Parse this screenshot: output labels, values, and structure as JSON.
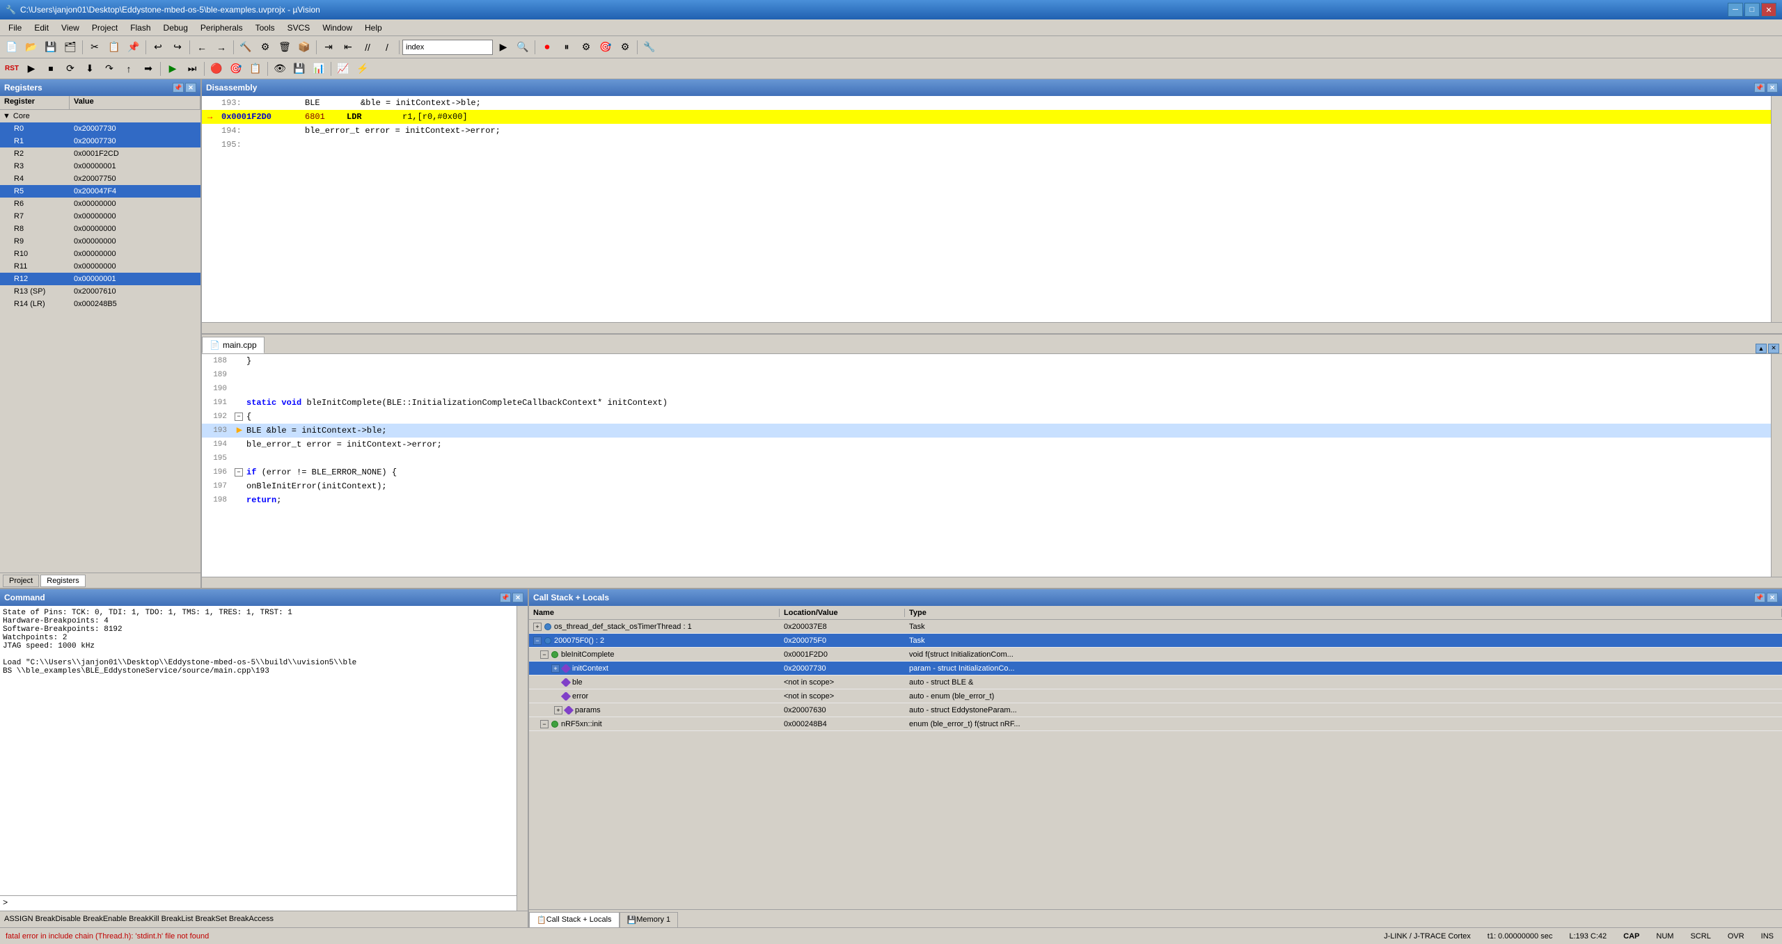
{
  "window": {
    "title": "C:\\Users\\janjon01\\Desktop\\Eddystone-mbed-os-5\\ble-examples.uvprojx - µVision"
  },
  "menu": {
    "items": [
      "File",
      "Edit",
      "View",
      "Project",
      "Flash",
      "Debug",
      "Peripherals",
      "Tools",
      "SVCS",
      "Window",
      "Help"
    ]
  },
  "toolbar": {
    "search_value": "index"
  },
  "registers_panel": {
    "title": "Registers",
    "col_register": "Register",
    "col_value": "Value",
    "core_label": "Core",
    "registers": [
      {
        "name": "R0",
        "value": "0x20007730",
        "highlighted": true
      },
      {
        "name": "R1",
        "value": "0x20007730",
        "highlighted": true
      },
      {
        "name": "R2",
        "value": "0x0001F2CD",
        "highlighted": false
      },
      {
        "name": "R3",
        "value": "0x00000001",
        "highlighted": false
      },
      {
        "name": "R4",
        "value": "0x20007750",
        "highlighted": false
      },
      {
        "name": "R5",
        "value": "0x200047F4",
        "highlighted": true
      },
      {
        "name": "R6",
        "value": "0x00000000",
        "highlighted": false
      },
      {
        "name": "R7",
        "value": "0x00000000",
        "highlighted": false
      },
      {
        "name": "R8",
        "value": "0x00000000",
        "highlighted": false
      },
      {
        "name": "R9",
        "value": "0x00000000",
        "highlighted": false
      },
      {
        "name": "R10",
        "value": "0x00000000",
        "highlighted": false
      },
      {
        "name": "R11",
        "value": "0x00000000",
        "highlighted": false
      },
      {
        "name": "R12",
        "value": "0x00000001",
        "highlighted": true
      },
      {
        "name": "R13 (SP)",
        "value": "0x20007610",
        "highlighted": false
      },
      {
        "name": "R14 (LR)",
        "value": "0x000248B5",
        "highlighted": false
      }
    ]
  },
  "disassembly_panel": {
    "title": "Disassembly",
    "lines": [
      {
        "addr": "193:",
        "instr": "BLE",
        "operand": "&ble = initContext->ble;",
        "highlight": false
      },
      {
        "addr": "0x0001F2D0",
        "opcode": "6801",
        "instr": "LDR",
        "operand": "r1,[r0,#0x00]",
        "highlight": true,
        "arrow": true
      },
      {
        "addr": "194:",
        "instr": "ble_error_t error = initContext->error;",
        "operand": "",
        "highlight": false
      },
      {
        "addr": "195:",
        "instr": "",
        "operand": "",
        "highlight": false
      }
    ]
  },
  "code_panel": {
    "tab_name": "main.cpp",
    "lines": [
      {
        "num": "188",
        "content": "}",
        "indent": 0
      },
      {
        "num": "189",
        "content": "",
        "indent": 0
      },
      {
        "num": "190",
        "content": "",
        "indent": 0
      },
      {
        "num": "191",
        "content": "static void bleInitComplete(BLE::InitializationCompleteCallbackContext* initContext)",
        "indent": 0,
        "keyword": false
      },
      {
        "num": "192",
        "content": "{",
        "indent": 0,
        "fold": true
      },
      {
        "num": "193",
        "content": "    BLE        &ble = initContext->ble;",
        "indent": 1,
        "current": true
      },
      {
        "num": "194",
        "content": "    ble_error_t error = initContext->error;",
        "indent": 1
      },
      {
        "num": "195",
        "content": "",
        "indent": 0
      },
      {
        "num": "196",
        "content": "    if (error != BLE_ERROR_NONE) {",
        "indent": 1,
        "fold": true
      },
      {
        "num": "197",
        "content": "        onBleInitError(initContext);",
        "indent": 2
      },
      {
        "num": "198",
        "content": "        return;",
        "indent": 2
      }
    ]
  },
  "command_panel": {
    "title": "Command",
    "output": [
      "State of Pins: TCK: 0, TDI: 1, TDO: 1, TMS: 1, TRES: 1, TRST: 1",
      "Hardware-Breakpoints:  4",
      "Software-Breakpoints: 8192",
      "Watchpoints:          2",
      "JTAG speed: 1000 kHz",
      "",
      "Load \"C:\\\\Users\\\\janjon01\\\\Desktop\\\\Eddystone-mbed-os-5\\\\build\\\\uvision5\\\\ble",
      "BS \\\\ble_examples\\BLE_EddystoneService/source/main.cpp\\193"
    ],
    "prompt": ">",
    "bottom_text": "ASSIGN BreakDisable BreakEnable BreakKill BreakList BreakSet BreakAccess"
  },
  "callstack_panel": {
    "title": "Call Stack + Locals",
    "col_name": "Name",
    "col_location": "Location/Value",
    "col_type": "Type",
    "rows": [
      {
        "name": "os_thread_def_stack_osTimerThread : 1",
        "location": "0x200037E8",
        "type": "Task",
        "indent": 0,
        "expand": true,
        "icon": "blue"
      },
      {
        "name": "200075F0() : 2",
        "location": "0x200075F0",
        "type": "Task",
        "indent": 0,
        "expand": true,
        "selected": true,
        "icon": "blue",
        "expanded": true
      },
      {
        "name": "bleInitComplete",
        "location": "0x0001F2D0",
        "type": "void f(struct InitializationCom...",
        "indent": 1,
        "expand": true,
        "icon": "green",
        "expanded": true
      },
      {
        "name": "initContext",
        "location": "0x20007730",
        "type": "param - struct InitializationCo...",
        "indent": 2,
        "expand": true,
        "icon": "diamond",
        "selected": true
      },
      {
        "name": "ble",
        "location": "<not in scope>",
        "type": "auto - struct BLE &",
        "indent": 2,
        "icon": "diamond"
      },
      {
        "name": "error",
        "location": "<not in scope>",
        "type": "auto - enum (ble_error_t)",
        "indent": 2,
        "icon": "diamond"
      },
      {
        "name": "params",
        "location": "0x20007630",
        "type": "auto - struct EddystoneParam...",
        "indent": 2,
        "expand": true,
        "icon": "diamond"
      },
      {
        "name": "nRF5xn::init",
        "location": "0x000248B4",
        "type": "enum (ble_error_t) f(struct nRF...",
        "indent": 1,
        "expand": true,
        "icon": "green",
        "collapsed": true
      }
    ],
    "tabs": [
      "Call Stack + Locals",
      "Memory 1"
    ]
  },
  "status_bar": {
    "error_text": "fatal error in include chain (Thread.h): 'stdint.h' file not found",
    "debug_info": "J-LINK / J-TRACE Cortex",
    "time": "t1: 0.00000000 sec",
    "position": "L:193 C:42",
    "cap": "CAP",
    "num": "NUM",
    "scrl": "SCRL",
    "ovr": "OVR",
    "ins": "INS"
  }
}
